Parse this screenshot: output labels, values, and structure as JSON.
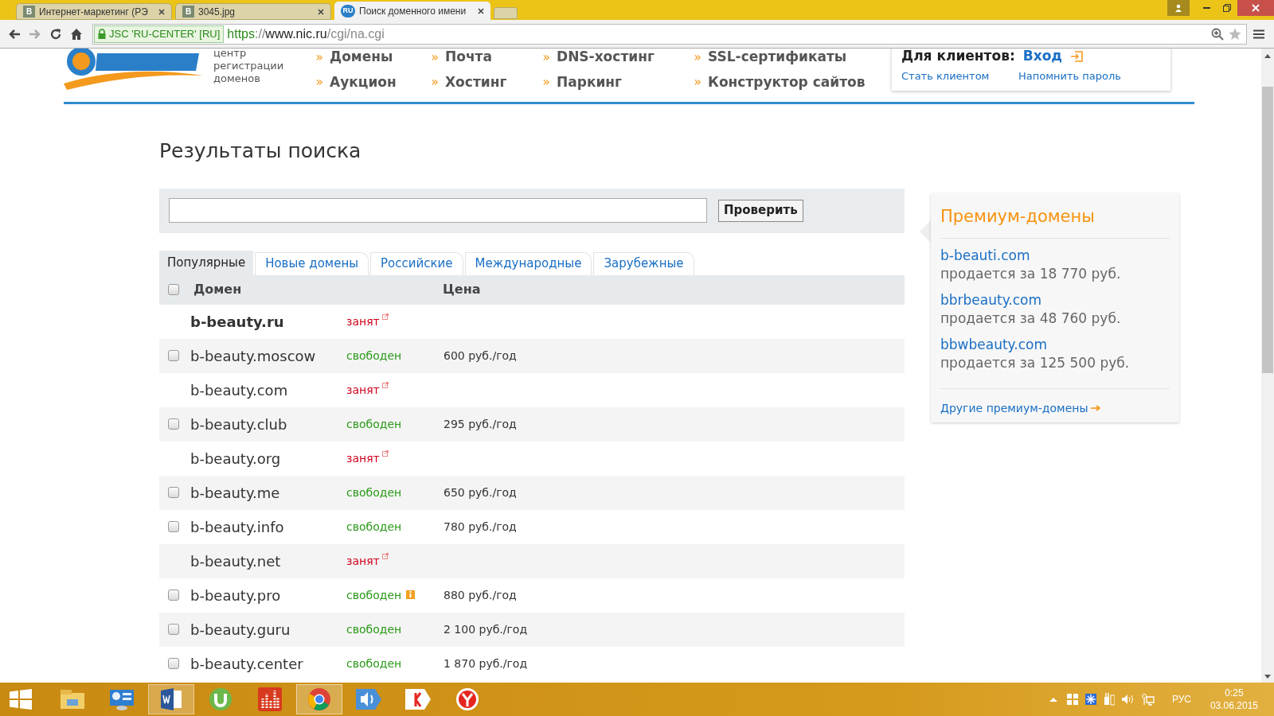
{
  "browser": {
    "tabs": [
      {
        "title": "Интернет-маркетинг (РЭ",
        "favicon": "В",
        "selected": false
      },
      {
        "title": "3045.jpg",
        "favicon": "В",
        "selected": false
      },
      {
        "title": "Поиск доменного имени",
        "favicon": "RU",
        "selected": true
      }
    ],
    "secure_label": "JSC 'RU-CENTER' [RU]",
    "url_scheme": "https",
    "url_sep": "://",
    "url_host": "www.nic.ru",
    "url_path": "/cgi/na.cgi"
  },
  "header": {
    "logo_tagline": [
      "центр",
      "регистрации",
      "доменов"
    ],
    "nav": [
      [
        "Домены",
        "Аукцион"
      ],
      [
        "Почта",
        "Хостинг"
      ],
      [
        "DNS-хостинг",
        "Паркинг"
      ],
      [
        "SSL-сертификаты",
        "Конструктор сайтов"
      ]
    ],
    "nav_bullet": "»",
    "clients_label": "Для клиентов:",
    "login": "Вход",
    "become_client": "Стать клиентом",
    "remind_password": "Напомнить пароль"
  },
  "page_title": "Результаты поиска",
  "search": {
    "button": "Проверить"
  },
  "tabs": [
    {
      "label": "Популярные",
      "selected": true
    },
    {
      "label": "Новые домены",
      "selected": false
    },
    {
      "label": "Российские",
      "selected": false
    },
    {
      "label": "Международные",
      "selected": false
    },
    {
      "label": "Зарубежные",
      "selected": false
    }
  ],
  "table": {
    "columns": [
      "Домен",
      "Цена"
    ],
    "select_all_checked": false,
    "rows": [
      {
        "domain": "b-beauty.ru",
        "kind": "taken",
        "status": "занят",
        "emphasized": true
      },
      {
        "domain": "b-beauty.moscow",
        "kind": "free",
        "status": "свободен",
        "price": "600 руб./год",
        "checked": false
      },
      {
        "domain": "b-beauty.com",
        "kind": "taken",
        "status": "занят",
        "emphasized": false
      },
      {
        "domain": "b-beauty.club",
        "kind": "free",
        "status": "свободен",
        "price": "295 руб./год",
        "checked": false
      },
      {
        "domain": "b-beauty.org",
        "kind": "taken",
        "status": "занят",
        "emphasized": false
      },
      {
        "domain": "b-beauty.me",
        "kind": "free",
        "status": "свободен",
        "price": "650 руб./год",
        "checked": false
      },
      {
        "domain": "b-beauty.info",
        "kind": "free",
        "status": "свободен",
        "price": "780 руб./год",
        "checked": false
      },
      {
        "domain": "b-beauty.net",
        "kind": "taken",
        "status": "занят",
        "emphasized": false
      },
      {
        "domain": "b-beauty.pro",
        "kind": "free",
        "status": "свободен",
        "price": "880 руб./год",
        "checked": false,
        "info": true
      },
      {
        "domain": "b-beauty.guru",
        "kind": "free",
        "status": "свободен",
        "price": "2 100 руб./год",
        "checked": false
      },
      {
        "domain": "b-beauty.center",
        "kind": "free",
        "status": "свободен",
        "price": "1 870 руб./год",
        "checked": false
      }
    ]
  },
  "premium": {
    "title": "Премиум-домены",
    "items": [
      {
        "domain": "b-beauti.com",
        "offer": "продается за 18 770 руб."
      },
      {
        "domain": "bbrbeauty.com",
        "offer": "продается за 48 760 руб."
      },
      {
        "domain": "bbwbeauty.com",
        "offer": "продается за 125 500 руб."
      }
    ],
    "more": "Другие премиум-домены"
  },
  "taskbar": {
    "lang": "РУС",
    "time": "0:25",
    "date": "03.06.2015"
  }
}
